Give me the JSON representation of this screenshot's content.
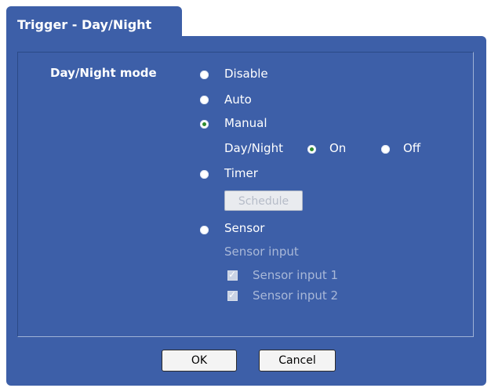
{
  "tab": {
    "title": "Trigger - Day/Night"
  },
  "mode": {
    "label": "Day/Night mode",
    "options": [
      {
        "label": "Disable",
        "checked": false
      },
      {
        "label": "Auto",
        "checked": false
      },
      {
        "label": "Manual",
        "checked": true
      },
      {
        "label": "Timer",
        "checked": false
      },
      {
        "label": "Sensor",
        "checked": false
      }
    ]
  },
  "manual": {
    "label": "Day/Night",
    "on_label": "On",
    "off_label": "Off",
    "selected": "On"
  },
  "timer": {
    "schedule_label": "Schedule"
  },
  "sensor": {
    "input_label": "Sensor input",
    "inputs": [
      {
        "label": "Sensor input 1",
        "checked": true
      },
      {
        "label": "Sensor input 2",
        "checked": true
      }
    ]
  },
  "buttons": {
    "ok": "OK",
    "cancel": "Cancel"
  }
}
